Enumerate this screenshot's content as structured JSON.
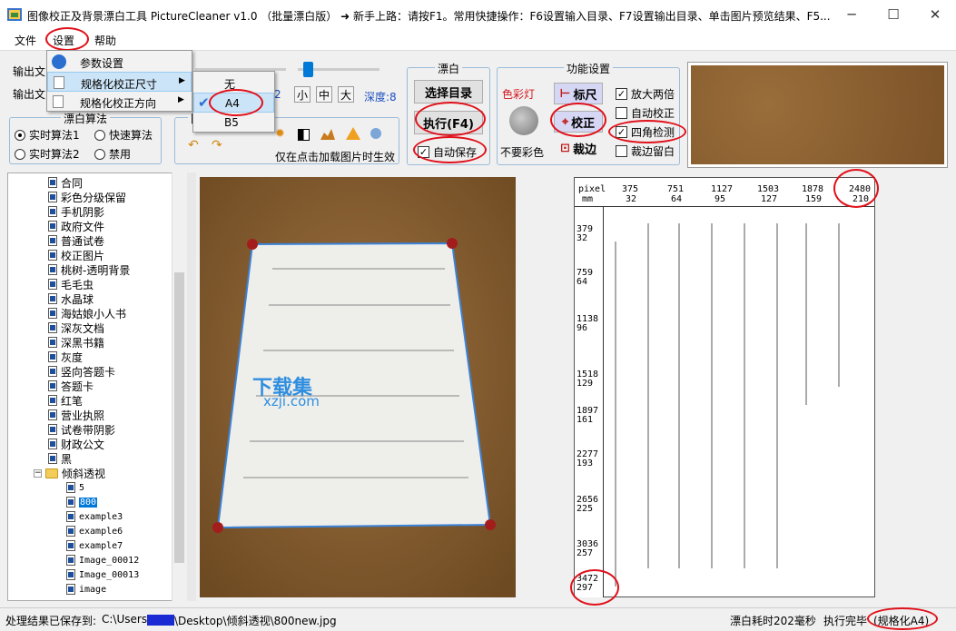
{
  "window": {
    "title": "图像校正及背景漂白工具 PictureCleaner v1.0 （批量漂白版） ➜ 新手上路：请按F1。常用快捷操作：F6设置输入目录、F7设置输出目录、单击图片预览结果、F5..."
  },
  "menu": {
    "file": "文件",
    "settings": "设置",
    "help": "帮助"
  },
  "dropdown": {
    "items": [
      "参数设置",
      "规格化校正尺寸",
      "规格化校正方向"
    ]
  },
  "submenu": {
    "items": [
      "无",
      "A4",
      "B5"
    ]
  },
  "left_panel": {
    "output_label_1": "输出文",
    "output_label_2": "输出文",
    "algo_group": "漂白算法",
    "radio_realtime1": "实时算法1",
    "radio_fast": "快速算法",
    "radio_realtime2": "实时算法2",
    "radio_disable": "禁用",
    "img_group": "图",
    "slider_value": "2",
    "size_small": "小",
    "size_mid": "中",
    "size_big": "大",
    "depth": "深度:8",
    "note": "仅在点击加载图片时生效"
  },
  "bleach_group": {
    "title": "漂白",
    "select_dir": "选择目录",
    "execute": "执行(F4)",
    "autosave": "自动保存"
  },
  "func_group": {
    "title": "功能设置",
    "color_light": "色彩灯",
    "no_color": "不要彩色",
    "ruler": "标尺",
    "correct": "校正",
    "crop": "裁边",
    "enlarge": "放大两倍",
    "auto_correct": "自动校正",
    "four_corner": "四角检测",
    "crop_margin": "裁边留白"
  },
  "tree": {
    "items": [
      "合同",
      "彩色分级保留",
      "手机阴影",
      "政府文件",
      "普通试卷",
      "校正图片",
      "桃树-透明背景",
      "毛毛虫",
      "水晶球",
      "海姑娘小人书",
      "深灰文档",
      "深黑书籍",
      "灰度",
      "竖向答题卡",
      "答题卡",
      "红笔",
      "营业执照",
      "试卷带阴影",
      "财政公文",
      "黑"
    ],
    "folder": "倾斜透视",
    "subitems": [
      "5",
      "800",
      "example3",
      "example6",
      "example7",
      "Image_00012",
      "Image_00013",
      "image"
    ]
  },
  "ruler": {
    "unit_pixel": "pixel",
    "unit_mm": "mm",
    "top_pixel": [
      "375",
      "751",
      "1127",
      "1503",
      "1878",
      "2480"
    ],
    "top_mm": [
      "32",
      "64",
      "95",
      "127",
      "159",
      "210"
    ],
    "left_pixel": [
      "379",
      "759",
      "1138",
      "1518",
      "1897",
      "2277",
      "2656",
      "3036",
      "3472"
    ],
    "left_mm": [
      "32",
      "64",
      "96",
      "129",
      "161",
      "193",
      "225",
      "257",
      "297"
    ]
  },
  "watermark": {
    "main": "下载集",
    "sub": "xzji.com"
  },
  "status": {
    "saved_to": "处理结果已保存到:",
    "path_prefix": "C:\\Users\\",
    "path_suffix": "\\Desktop\\倾斜透视\\800new.jpg",
    "time": "漂白耗时202毫秒",
    "done": "执行完毕",
    "normalized": "(规格化A4)"
  },
  "colors": {
    "accent": "#0078d7",
    "annotation": "#e0101a",
    "board": "#8d6436"
  }
}
